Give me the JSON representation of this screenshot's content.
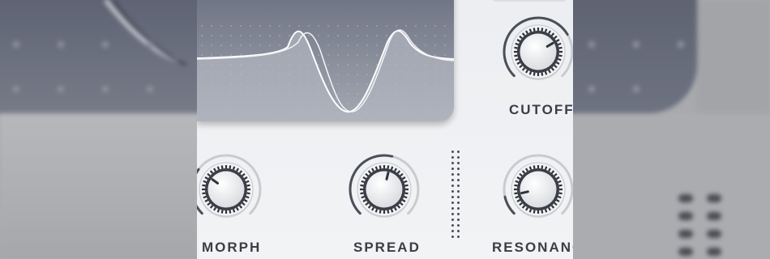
{
  "synth": {
    "knobs": [
      {
        "id": "cutoff",
        "label": "CUTOFF",
        "value": 0.72
      },
      {
        "id": "morph",
        "label": "MORPH",
        "value": 0.3
      },
      {
        "id": "spread",
        "label": "SPREAD",
        "value": 0.55
      },
      {
        "id": "resonance",
        "label": "RESONANCE",
        "value": 0.12
      }
    ]
  },
  "colors": {
    "panel": "#eef0f2",
    "screen_top": "#6d7282",
    "screen_bottom": "#a5a9b3",
    "label": "#3a3d45",
    "knob_arc": "#4b4f58"
  }
}
